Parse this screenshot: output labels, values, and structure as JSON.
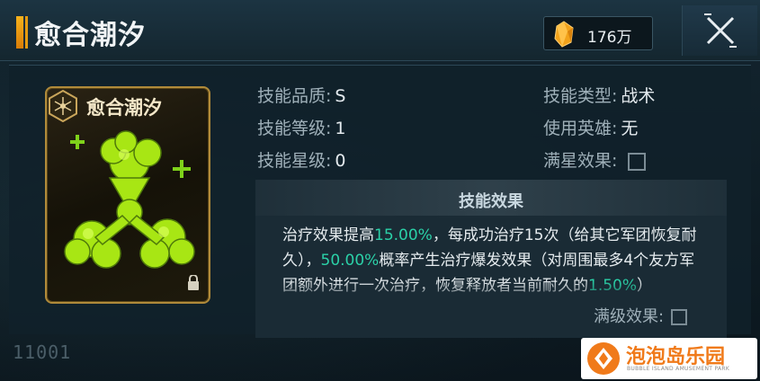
{
  "header": {
    "title": "愈合潮汐",
    "currency_amount": "176万",
    "currency_icon": "crystal-icon",
    "close_icon": "close-icon"
  },
  "card": {
    "name": "愈合潮汐",
    "badge_icon": "hexagon-emblem-icon",
    "art_icon": "healing-slime-icon",
    "lock_icon": "lock-icon"
  },
  "attributes": {
    "quality_label": "技能品质:",
    "quality_value": "S",
    "level_label": "技能等级:",
    "level_value": "1",
    "star_label": "技能星级:",
    "star_value": "0",
    "type_label": "技能类型:",
    "type_value": "战术",
    "hero_label": "使用英雄:",
    "hero_value": "无",
    "fullstar_label": "满星效果:"
  },
  "effect": {
    "title": "技能效果",
    "text_1": "治疗效果提高",
    "hl_1": "15.00%",
    "text_2": "，每成功治疗15次（给其它军团恢复耐久），",
    "hl_2": "50.00%",
    "text_3": "概率产生治疗爆发效果（对周围最多4个友方军团额外进行一次治疗，恢复释放者当前耐久的",
    "hl_3": "1.50%",
    "text_4": "）",
    "maxlevel_label": "满级效果:"
  },
  "footer": {
    "serial": "11001"
  },
  "watermark": {
    "title": "泡泡岛乐园",
    "subtitle": "BUBBLE ISLAND AMUSEMENT PARK"
  },
  "colors": {
    "accent_orange": "#f6b21c",
    "highlight_teal": "#2bd1a8",
    "slime_green": "#a8e614"
  }
}
